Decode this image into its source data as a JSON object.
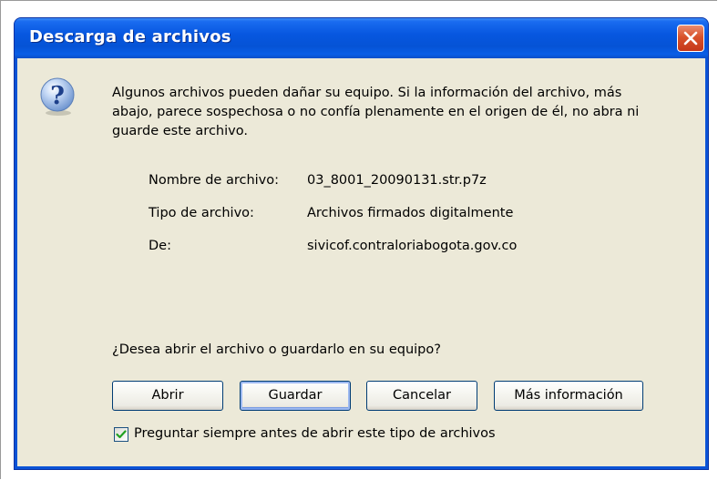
{
  "dialog": {
    "title": "Descarga de archivos",
    "message": "Algunos archivos pueden dañar su equipo. Si la información del archivo, más abajo, parece sospechosa o no confía plenamente en el origen de él, no abra ni guarde este archivo.",
    "file_info": [
      {
        "label": "Nombre de archivo:",
        "value": "03_8001_20090131.str.p7z"
      },
      {
        "label": "Tipo de archivo:",
        "value": "Archivos firmados digitalmente"
      },
      {
        "label": "De:",
        "value": "sivicof.contraloriabogota.gov.co"
      }
    ],
    "prompt": "¿Desea abrir el archivo o guardarlo en su equipo?",
    "buttons": {
      "open": "Abrir",
      "save": "Guardar",
      "cancel": "Cancelar",
      "more_info": "Más información"
    },
    "checkbox": {
      "label": "Preguntar siempre antes de abrir este tipo de archivos",
      "checked": true
    }
  },
  "icons": {
    "question": "question-icon",
    "close": "close-icon",
    "check": "checkmark-icon"
  },
  "colors": {
    "titlebar": "#0a53d6",
    "client_background": "#ece9d8",
    "close_button": "#d9522b",
    "checkmark": "#21a121",
    "button_border": "#003c74"
  }
}
